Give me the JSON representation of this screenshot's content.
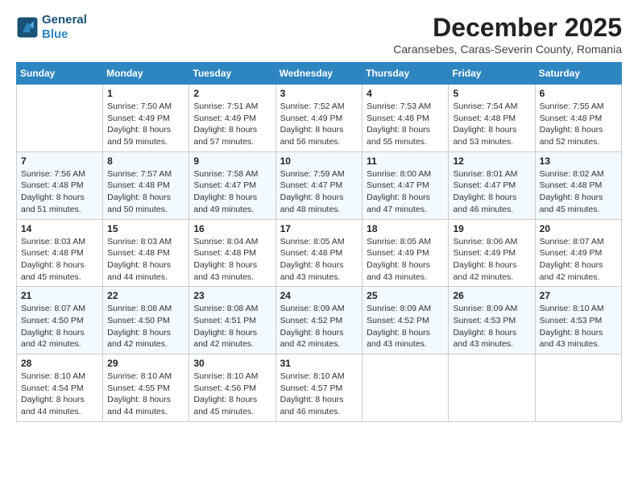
{
  "logo": {
    "line1": "General",
    "line2": "Blue"
  },
  "title": "December 2025",
  "subtitle": "Caransebes, Caras-Severin County, Romania",
  "days_of_week": [
    "Sunday",
    "Monday",
    "Tuesday",
    "Wednesday",
    "Thursday",
    "Friday",
    "Saturday"
  ],
  "weeks": [
    [
      {
        "day": "",
        "sunrise": "",
        "sunset": "",
        "daylight": ""
      },
      {
        "day": "1",
        "sunrise": "Sunrise: 7:50 AM",
        "sunset": "Sunset: 4:49 PM",
        "daylight": "Daylight: 8 hours and 59 minutes."
      },
      {
        "day": "2",
        "sunrise": "Sunrise: 7:51 AM",
        "sunset": "Sunset: 4:49 PM",
        "daylight": "Daylight: 8 hours and 57 minutes."
      },
      {
        "day": "3",
        "sunrise": "Sunrise: 7:52 AM",
        "sunset": "Sunset: 4:49 PM",
        "daylight": "Daylight: 8 hours and 56 minutes."
      },
      {
        "day": "4",
        "sunrise": "Sunrise: 7:53 AM",
        "sunset": "Sunset: 4:48 PM",
        "daylight": "Daylight: 8 hours and 55 minutes."
      },
      {
        "day": "5",
        "sunrise": "Sunrise: 7:54 AM",
        "sunset": "Sunset: 4:48 PM",
        "daylight": "Daylight: 8 hours and 53 minutes."
      },
      {
        "day": "6",
        "sunrise": "Sunrise: 7:55 AM",
        "sunset": "Sunset: 4:48 PM",
        "daylight": "Daylight: 8 hours and 52 minutes."
      }
    ],
    [
      {
        "day": "7",
        "sunrise": "Sunrise: 7:56 AM",
        "sunset": "Sunset: 4:48 PM",
        "daylight": "Daylight: 8 hours and 51 minutes."
      },
      {
        "day": "8",
        "sunrise": "Sunrise: 7:57 AM",
        "sunset": "Sunset: 4:48 PM",
        "daylight": "Daylight: 8 hours and 50 minutes."
      },
      {
        "day": "9",
        "sunrise": "Sunrise: 7:58 AM",
        "sunset": "Sunset: 4:47 PM",
        "daylight": "Daylight: 8 hours and 49 minutes."
      },
      {
        "day": "10",
        "sunrise": "Sunrise: 7:59 AM",
        "sunset": "Sunset: 4:47 PM",
        "daylight": "Daylight: 8 hours and 48 minutes."
      },
      {
        "day": "11",
        "sunrise": "Sunrise: 8:00 AM",
        "sunset": "Sunset: 4:47 PM",
        "daylight": "Daylight: 8 hours and 47 minutes."
      },
      {
        "day": "12",
        "sunrise": "Sunrise: 8:01 AM",
        "sunset": "Sunset: 4:47 PM",
        "daylight": "Daylight: 8 hours and 46 minutes."
      },
      {
        "day": "13",
        "sunrise": "Sunrise: 8:02 AM",
        "sunset": "Sunset: 4:48 PM",
        "daylight": "Daylight: 8 hours and 45 minutes."
      }
    ],
    [
      {
        "day": "14",
        "sunrise": "Sunrise: 8:03 AM",
        "sunset": "Sunset: 4:48 PM",
        "daylight": "Daylight: 8 hours and 45 minutes."
      },
      {
        "day": "15",
        "sunrise": "Sunrise: 8:03 AM",
        "sunset": "Sunset: 4:48 PM",
        "daylight": "Daylight: 8 hours and 44 minutes."
      },
      {
        "day": "16",
        "sunrise": "Sunrise: 8:04 AM",
        "sunset": "Sunset: 4:48 PM",
        "daylight": "Daylight: 8 hours and 43 minutes."
      },
      {
        "day": "17",
        "sunrise": "Sunrise: 8:05 AM",
        "sunset": "Sunset: 4:48 PM",
        "daylight": "Daylight: 8 hours and 43 minutes."
      },
      {
        "day": "18",
        "sunrise": "Sunrise: 8:05 AM",
        "sunset": "Sunset: 4:49 PM",
        "daylight": "Daylight: 8 hours and 43 minutes."
      },
      {
        "day": "19",
        "sunrise": "Sunrise: 8:06 AM",
        "sunset": "Sunset: 4:49 PM",
        "daylight": "Daylight: 8 hours and 42 minutes."
      },
      {
        "day": "20",
        "sunrise": "Sunrise: 8:07 AM",
        "sunset": "Sunset: 4:49 PM",
        "daylight": "Daylight: 8 hours and 42 minutes."
      }
    ],
    [
      {
        "day": "21",
        "sunrise": "Sunrise: 8:07 AM",
        "sunset": "Sunset: 4:50 PM",
        "daylight": "Daylight: 8 hours and 42 minutes."
      },
      {
        "day": "22",
        "sunrise": "Sunrise: 8:08 AM",
        "sunset": "Sunset: 4:50 PM",
        "daylight": "Daylight: 8 hours and 42 minutes."
      },
      {
        "day": "23",
        "sunrise": "Sunrise: 8:08 AM",
        "sunset": "Sunset: 4:51 PM",
        "daylight": "Daylight: 8 hours and 42 minutes."
      },
      {
        "day": "24",
        "sunrise": "Sunrise: 8:09 AM",
        "sunset": "Sunset: 4:52 PM",
        "daylight": "Daylight: 8 hours and 42 minutes."
      },
      {
        "day": "25",
        "sunrise": "Sunrise: 8:09 AM",
        "sunset": "Sunset: 4:52 PM",
        "daylight": "Daylight: 8 hours and 43 minutes."
      },
      {
        "day": "26",
        "sunrise": "Sunrise: 8:09 AM",
        "sunset": "Sunset: 4:53 PM",
        "daylight": "Daylight: 8 hours and 43 minutes."
      },
      {
        "day": "27",
        "sunrise": "Sunrise: 8:10 AM",
        "sunset": "Sunset: 4:53 PM",
        "daylight": "Daylight: 8 hours and 43 minutes."
      }
    ],
    [
      {
        "day": "28",
        "sunrise": "Sunrise: 8:10 AM",
        "sunset": "Sunset: 4:54 PM",
        "daylight": "Daylight: 8 hours and 44 minutes."
      },
      {
        "day": "29",
        "sunrise": "Sunrise: 8:10 AM",
        "sunset": "Sunset: 4:55 PM",
        "daylight": "Daylight: 8 hours and 44 minutes."
      },
      {
        "day": "30",
        "sunrise": "Sunrise: 8:10 AM",
        "sunset": "Sunset: 4:56 PM",
        "daylight": "Daylight: 8 hours and 45 minutes."
      },
      {
        "day": "31",
        "sunrise": "Sunrise: 8:10 AM",
        "sunset": "Sunset: 4:57 PM",
        "daylight": "Daylight: 8 hours and 46 minutes."
      },
      {
        "day": "",
        "sunrise": "",
        "sunset": "",
        "daylight": ""
      },
      {
        "day": "",
        "sunrise": "",
        "sunset": "",
        "daylight": ""
      },
      {
        "day": "",
        "sunrise": "",
        "sunset": "",
        "daylight": ""
      }
    ]
  ]
}
